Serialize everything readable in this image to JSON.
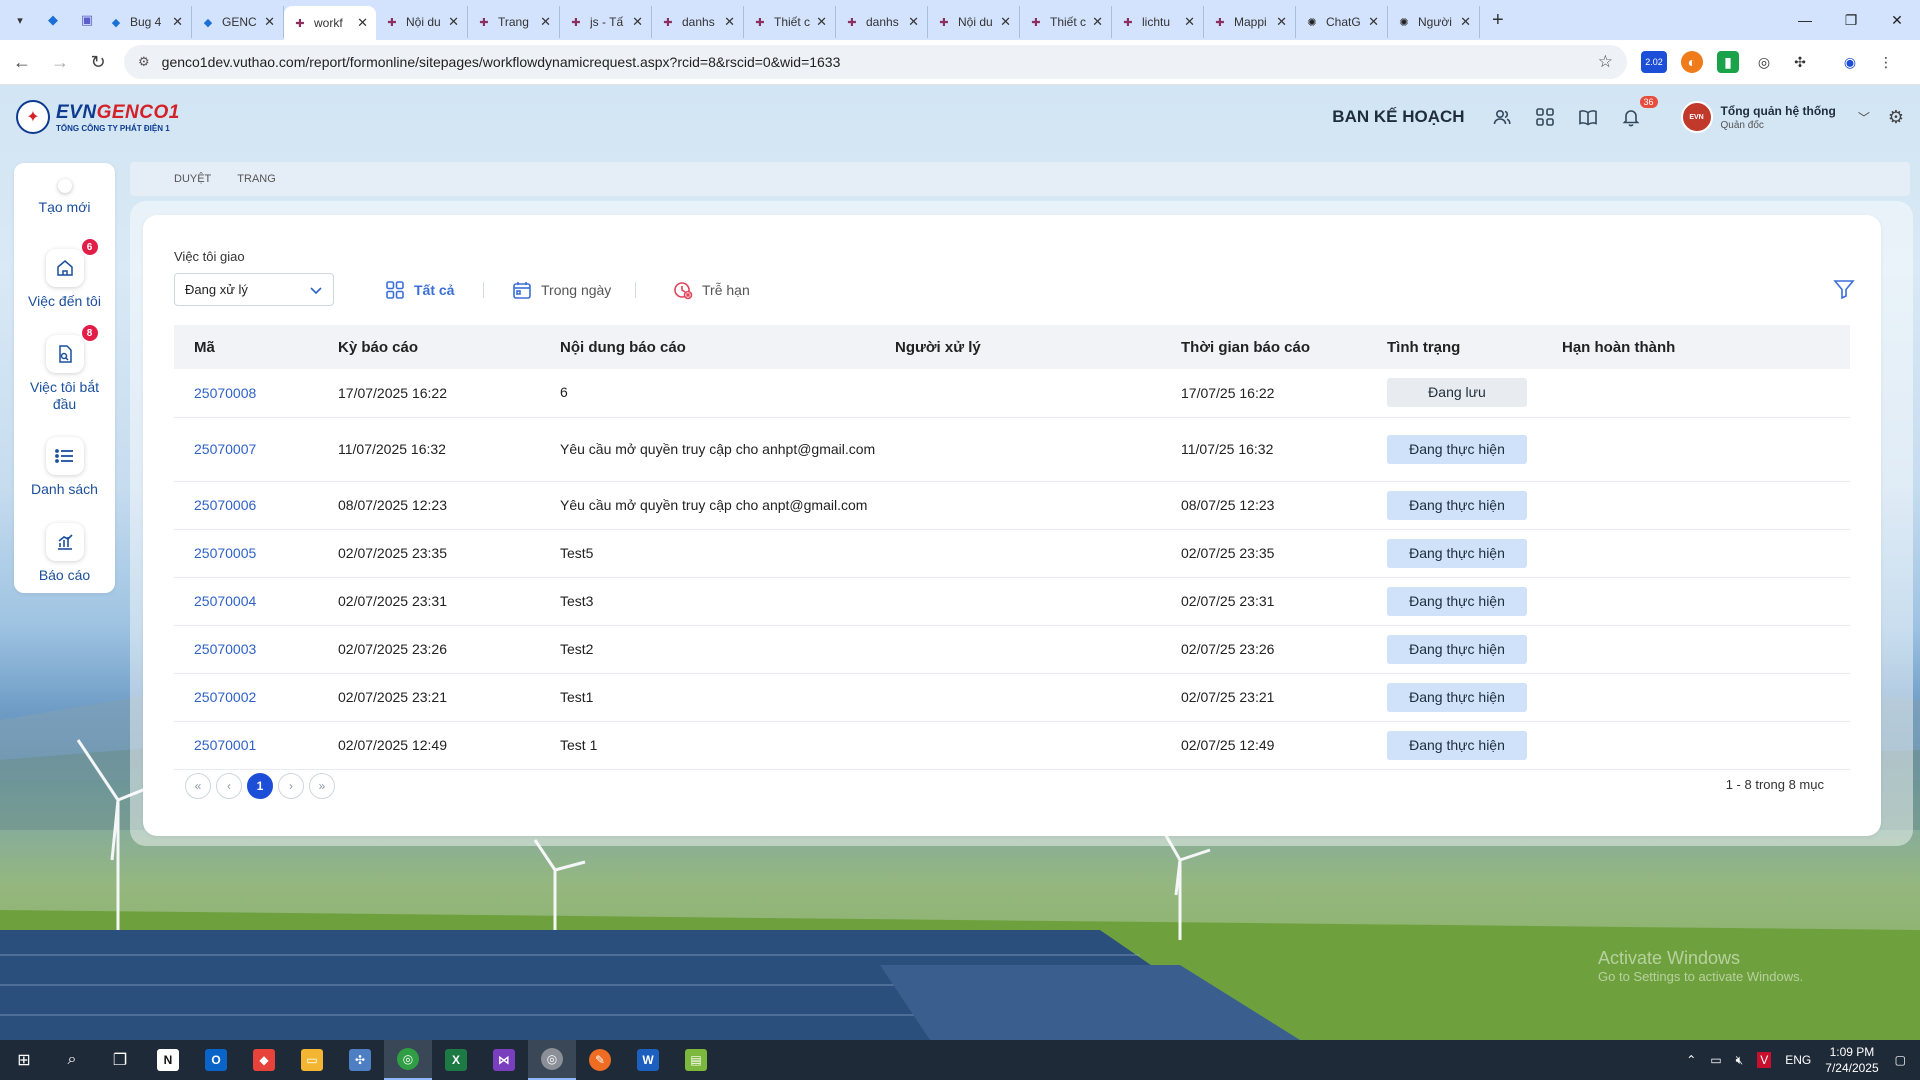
{
  "browser": {
    "tabs": [
      {
        "title": "Bug 4",
        "icon": "devops-icon",
        "active": false
      },
      {
        "title": "GENC",
        "icon": "devops-icon",
        "active": false
      },
      {
        "title": "workf",
        "icon": "evn-icon",
        "active": true
      },
      {
        "title": "Nội du",
        "icon": "evn-icon",
        "active": false
      },
      {
        "title": "Trang",
        "icon": "evn-icon",
        "active": false
      },
      {
        "title": "js - Tấ",
        "icon": "evn-icon",
        "active": false
      },
      {
        "title": "danhs",
        "icon": "evn-icon",
        "active": false
      },
      {
        "title": "Thiết c",
        "icon": "evn-icon",
        "active": false
      },
      {
        "title": "danhs",
        "icon": "evn-icon",
        "active": false
      },
      {
        "title": "Nội du",
        "icon": "evn-icon",
        "active": false
      },
      {
        "title": "Thiết c",
        "icon": "evn-icon",
        "active": false
      },
      {
        "title": "lichtu",
        "icon": "evn-icon",
        "active": false
      },
      {
        "title": "Mappi",
        "icon": "evn-icon",
        "active": false
      },
      {
        "title": "ChatG",
        "icon": "chatgpt-icon",
        "active": false
      },
      {
        "title": "Người",
        "icon": "chatgpt-icon",
        "active": false
      }
    ],
    "url": "genco1dev.vuthao.com/report/formonline/sitepages/workflowdynamicrequest.aspx?rcid=8&rscid=0&wid=1633",
    "extension_badge": "2.02"
  },
  "header": {
    "logo_main": "EVNGENCO1",
    "logo_prefix": "EVN",
    "logo_suffix": "GENCO1",
    "logo_sub": "TỔNG CÔNG TY PHÁT ĐIỆN 1",
    "department": "BAN KẾ HOẠCH",
    "notification_count": "36",
    "user_name": "Tổng quản hệ thống",
    "user_role": "Quản đốc"
  },
  "sidebar": {
    "create_label": "Tạo mới",
    "items": [
      {
        "label": "Việc đến tôi",
        "badge": "6"
      },
      {
        "label": "Việc tôi bắt đầu",
        "badge": "8"
      },
      {
        "label": "Danh sách"
      },
      {
        "label": "Báo cáo"
      }
    ]
  },
  "breadcrumb": [
    "DUYỆT",
    "TRANG"
  ],
  "filters": {
    "label": "Việc tôi giao",
    "select_value": "Đang xử lý",
    "tab_all": "Tất cả",
    "tab_today": "Trong ngày",
    "tab_overdue": "Trễ hạn"
  },
  "table": {
    "columns": [
      "Mã",
      "Kỳ báo cáo",
      "Nội dung báo cáo",
      "Người xử lý",
      "Thời gian báo cáo",
      "Tình trạng",
      "Hạn hoàn thành"
    ],
    "rows": [
      {
        "code": "25070008",
        "period": "17/07/2025 16:22",
        "content": "6",
        "handler": "",
        "time": "17/07/25 16:22",
        "status": "Đang lưu",
        "deadline": ""
      },
      {
        "code": "25070007",
        "period": "11/07/2025 16:32",
        "content": "Yêu cầu mở quyền truy cập cho anhpt@gmail.com",
        "handler": "",
        "time": "11/07/25 16:32",
        "status": "Đang thực hiện",
        "deadline": ""
      },
      {
        "code": "25070006",
        "period": "08/07/2025 12:23",
        "content": "Yêu cầu mở quyền truy cập cho anpt@gmail.com",
        "handler": "",
        "time": "08/07/25 12:23",
        "status": "Đang thực hiện",
        "deadline": ""
      },
      {
        "code": "25070005",
        "period": "02/07/2025 23:35",
        "content": "Test5",
        "handler": "",
        "time": "02/07/25 23:35",
        "status": "Đang thực hiện",
        "deadline": ""
      },
      {
        "code": "25070004",
        "period": "02/07/2025 23:31",
        "content": "Test3",
        "handler": "",
        "time": "02/07/25 23:31",
        "status": "Đang thực hiện",
        "deadline": ""
      },
      {
        "code": "25070003",
        "period": "02/07/2025 23:26",
        "content": "Test2",
        "handler": "",
        "time": "02/07/25 23:26",
        "status": "Đang thực hiện",
        "deadline": ""
      },
      {
        "code": "25070002",
        "period": "02/07/2025 23:21",
        "content": "Test1",
        "handler": "",
        "time": "02/07/25 23:21",
        "status": "Đang thực hiện",
        "deadline": ""
      },
      {
        "code": "25070001",
        "period": "02/07/2025 12:49",
        "content": "Test 1",
        "handler": "",
        "time": "02/07/25 12:49",
        "status": "Đang thực hiện",
        "deadline": ""
      }
    ]
  },
  "pagination": {
    "current_page": "1",
    "summary": "1 - 8 trong 8 mục"
  },
  "watermark": {
    "line1": "Activate Windows",
    "line2": "Go to Settings to activate Windows."
  },
  "taskbar": {
    "language": "ENG",
    "time": "1:09 PM",
    "date": "7/24/2025"
  },
  "colors": {
    "accent": "#3b6fd8",
    "link": "#2f62c9",
    "badge": "#e11d48",
    "status_running_bg": "#cfe2f9",
    "status_saved_bg": "#e8ebef"
  }
}
